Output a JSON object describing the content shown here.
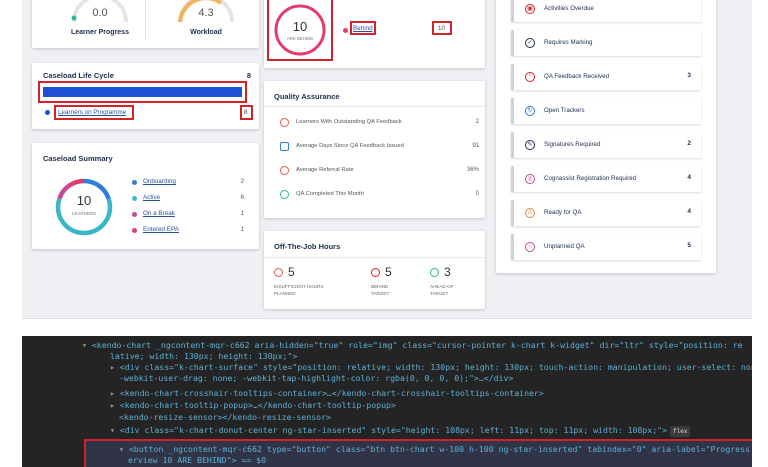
{
  "gauges": {
    "left": {
      "value": "0.0",
      "label": "Learner Progress"
    },
    "right": {
      "value": "4.3",
      "label": "Workload"
    }
  },
  "progress_overview": {
    "count": "10",
    "sub": "ARE BEHIND",
    "status_label": "Behind",
    "status_count": "10"
  },
  "caseload_life_cycle": {
    "title": "Caseload Life Cycle",
    "count": "8",
    "bar_fill_fraction": 1.0,
    "legend_label": "Learners on Programme",
    "legend_count": "8"
  },
  "caseload_summary": {
    "title": "Caseload Summary",
    "total": "10",
    "total_sub": "LEARNERS",
    "items": [
      {
        "label": "Onboarding",
        "count": "2",
        "color": "#2f7ed8"
      },
      {
        "label": "Active",
        "count": "6",
        "color": "#39b6c8"
      },
      {
        "label": "On a Break",
        "count": "1",
        "color": "#c8479b"
      },
      {
        "label": "Entered EPA",
        "count": "1",
        "color": "#e23c6d"
      }
    ]
  },
  "quality_assurance": {
    "title": "Quality Assurance",
    "rows": [
      {
        "label": "Learners With Outstanding QA Feedback",
        "value": "2",
        "color": "#e05a47"
      },
      {
        "label": "Average Days Since QA Feedback Issued",
        "value": "91",
        "color": "#2f7ed8"
      },
      {
        "label": "Average Referral Rate",
        "value": "36%",
        "color": "#e05a47"
      },
      {
        "label": "QA Completed This Month",
        "value": "0",
        "color": "#2fb39b"
      }
    ]
  },
  "off_the_job": {
    "title": "Off-The-Job Hours",
    "stats": [
      {
        "value": "5",
        "label1": "INSUFFICIENT HOURS",
        "label2": "PLANNED",
        "color": "#e05a47"
      },
      {
        "value": "5",
        "label1": "BEHIND",
        "label2": "TARGET",
        "color": "#d2232a"
      },
      {
        "value": "3",
        "label1": "AHEAD OF",
        "label2": "TARGET",
        "color": "#2fb39b"
      }
    ]
  },
  "right_list": [
    {
      "label": "Activities Overdue",
      "count": "",
      "color": "#d2232a",
      "glyph": "▣"
    },
    {
      "label": "Requires Marking",
      "count": "",
      "color": "#1e2d4d",
      "glyph": "✓"
    },
    {
      "label": "QA Feedback Received",
      "count": "3",
      "color": "#d2232a",
      "glyph": "!"
    },
    {
      "label": "Open Trackers",
      "count": "",
      "color": "#2f7ed8",
      "glyph": "↻"
    },
    {
      "label": "Signatures Required",
      "count": "2",
      "color": "#1e2d4d",
      "glyph": "✎"
    },
    {
      "label": "Cognassist Registration Required",
      "count": "4",
      "color": "#c8479b",
      "glyph": "◎"
    },
    {
      "label": "Ready for QA",
      "count": "4",
      "color": "#e08a3c",
      "glyph": "♙"
    },
    {
      "label": "Unplanned QA",
      "count": "5",
      "color": "#c8479b",
      "glyph": "−"
    }
  ],
  "devtools": {
    "lines": [
      "<kendo-chart _ngcontent-mqr-c662 aria-hidden=\"true\" role=\"img\" class=\"cursor-pointer k-chart k-widget\" dir=\"ltr\" style=\"position: re",
      "lative; width: 130px; height: 130px;\">",
      "<div class=\"k-chart-surface\" style=\"position: relative; width: 130px; height: 130px; touch-action: manipulation; user-select: none;",
      "-webkit-user-drag: none; -webkit-tap-highlight-color: rgba(0, 0, 0, 0);\">…</div>",
      "<kendo-chart-crosshair-tooltips-container>…</kendo-chart-crosshair-tooltips-container>",
      "<kendo-chart-tooltip-popup>…</kendo-chart-tooltip-popup>",
      "<kendo-resize-sensor></kendo-resize-sensor>",
      "<div class=\"k-chart-donut-center ng-star-inserted\" style=\"height: 108px; left: 11px; top: 11px; width: 108px;\">",
      "<button _ngcontent-mqr-c662 type=\"button\" class=\"btn btn-chart w-100 h-100 ng-star-inserted\" tabindex=\"0\" aria-label=\"Progress Ov",
      "erview 10 ARE BEHIND\"> == $0"
    ],
    "flex_badge": "flex"
  }
}
